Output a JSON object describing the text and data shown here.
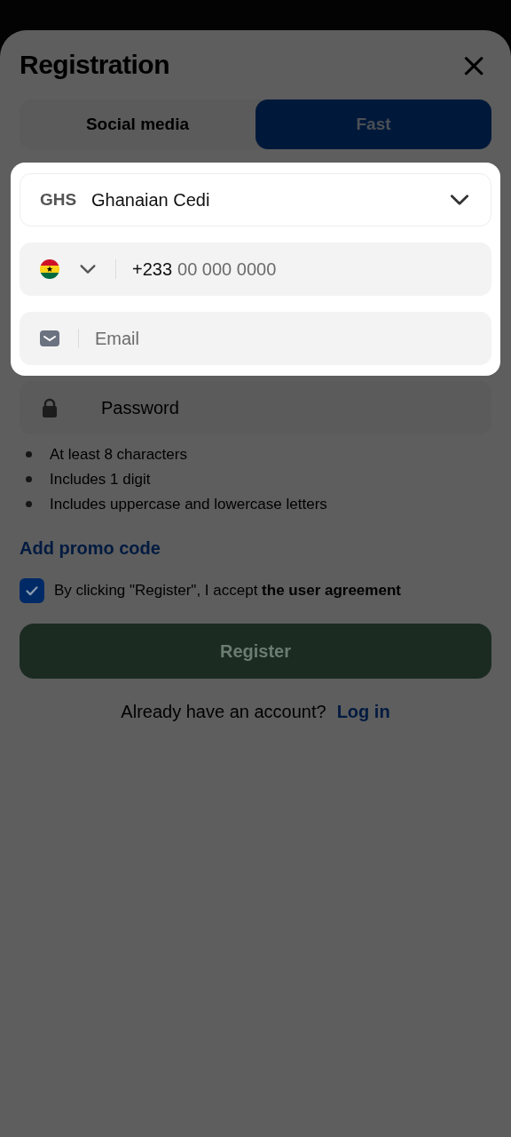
{
  "title": "Registration",
  "close": "×",
  "tabs": [
    {
      "label": "Social media",
      "selected": false
    },
    {
      "label": "Fast",
      "selected": true
    }
  ],
  "currency": {
    "code": "GHS",
    "name": "Ghanaian Cedi"
  },
  "phone": {
    "prefix": "+233",
    "placeholder": "00 000 0000"
  },
  "email": {
    "placeholder": "Email"
  },
  "password": {
    "placeholder": "Password"
  },
  "requirements": [
    "At least 8 characters",
    "Includes 1 digit",
    "Includes uppercase and lowercase letters"
  ],
  "promo_link": "Add promo code",
  "agreement": {
    "text": "By clicking \"Register\", I accept **the user agreement**",
    "checked": true
  },
  "register_button": "Register",
  "login_prompt": {
    "text": "Already have an account?",
    "link": "Log in"
  }
}
